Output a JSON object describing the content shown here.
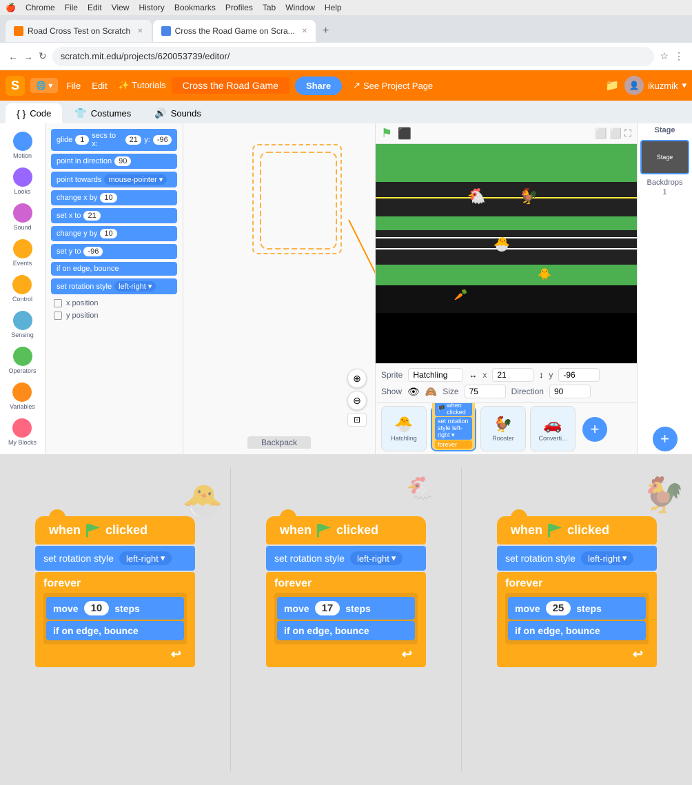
{
  "browser": {
    "menu_items": [
      "🍎",
      "Chrome",
      "File",
      "Edit",
      "View",
      "History",
      "Bookmarks",
      "Profiles",
      "Tab",
      "Window",
      "Help"
    ],
    "tabs": [
      {
        "label": "Road Cross Test on Scratch",
        "active": false,
        "favicon": "orange"
      },
      {
        "label": "Cross the Road Game on Scra...",
        "active": true,
        "favicon": "blue"
      }
    ],
    "address": "scratch.mit.edu/projects/620053739/editor/"
  },
  "scratch": {
    "nav": [
      "File",
      "Edit",
      "Tutorials"
    ],
    "project_title": "Cross the Road Game",
    "share_label": "Share",
    "see_project": "See Project Page",
    "username": "ikuzmik",
    "tabs": [
      "Code",
      "Costumes",
      "Sounds"
    ]
  },
  "blocks": {
    "categories": [
      {
        "name": "Motion",
        "color": "#4c97ff"
      },
      {
        "name": "Looks",
        "color": "#9966ff"
      },
      {
        "name": "Sound",
        "color": "#cf63cf"
      },
      {
        "name": "Events",
        "color": "#ffab19"
      },
      {
        "name": "Control",
        "color": "#ffab19"
      },
      {
        "name": "Sensing",
        "color": "#5cb1d6"
      },
      {
        "name": "Operators",
        "color": "#59c059"
      },
      {
        "name": "Variables",
        "color": "#ff8c1a"
      },
      {
        "name": "My Blocks",
        "color": "#ff6680"
      }
    ],
    "motion_blocks": [
      {
        "text": "glide",
        "val1": "1",
        "label2": "secs to x:",
        "val2": "21",
        "label3": "y:",
        "val3": "-96"
      },
      {
        "text": "point in direction",
        "val": "90"
      },
      {
        "text": "point towards",
        "dropdown": "mouse-pointer"
      },
      {
        "text": "change x by",
        "val": "10"
      },
      {
        "text": "set x to",
        "val": "21"
      },
      {
        "text": "change y by",
        "val": "10"
      },
      {
        "text": "set y to",
        "val": "-96"
      },
      {
        "text": "if on edge, bounce"
      },
      {
        "text": "set rotation style",
        "dropdown": "left-right"
      }
    ],
    "checkboxes": [
      "x position",
      "y position"
    ]
  },
  "sprite": {
    "name": "Hatchling",
    "x": "21",
    "y": "-96",
    "size": "75",
    "direction": "90"
  },
  "bottom_panels": [
    {
      "id": "panel1",
      "hat_label": "when",
      "flag_text": "🏴",
      "clicked_label": "clicked",
      "rotation_label": "set rotation style",
      "rotation_val": "left-right",
      "forever_label": "forever",
      "move_label": "move",
      "move_val": "10",
      "steps_label": "steps",
      "bounce_label": "if on edge, bounce"
    },
    {
      "id": "panel2",
      "hat_label": "when",
      "flag_text": "🏴",
      "clicked_label": "clicked",
      "rotation_label": "set rotation style",
      "rotation_val": "left-right",
      "forever_label": "forever",
      "move_label": "move",
      "move_val": "17",
      "steps_label": "steps",
      "bounce_label": "if on edge, bounce"
    },
    {
      "id": "panel3",
      "hat_label": "when",
      "flag_text": "🏴",
      "clicked_label": "clicked",
      "rotation_label": "set rotation style",
      "rotation_val": "left-right",
      "forever_label": "forever",
      "move_label": "move",
      "move_val": "25",
      "steps_label": "steps",
      "bounce_label": "if on edge, bounce"
    }
  ]
}
